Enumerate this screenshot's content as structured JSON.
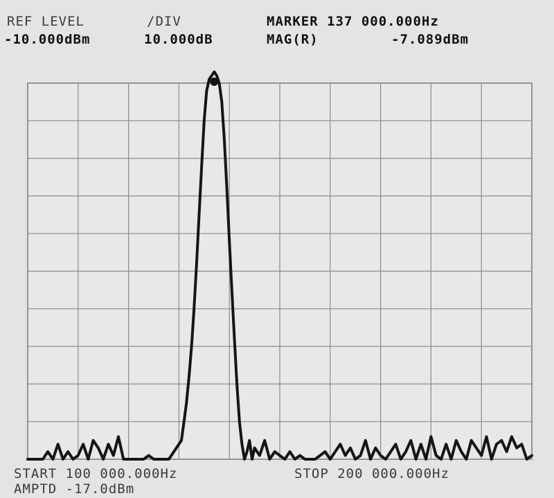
{
  "header": {
    "ref_level_label": "REF LEVEL",
    "ref_level_value": "-10.000dBm",
    "div_label": "/DIV",
    "div_value": "10.000dB",
    "marker_label": "MARKER 137 000.000Hz",
    "marker_mode": "MAG(R)",
    "marker_value": "-7.089dBm"
  },
  "footer": {
    "start": "START 100 000.000Hz",
    "stop": "STOP 200 000.000Hz",
    "amptd": "AMPTD -17.0dBm"
  },
  "chart_data": {
    "type": "line",
    "title": "",
    "xlabel": "",
    "ylabel": "",
    "x_unit": "Hz",
    "y_unit": "dBm",
    "xlim": [
      100000,
      200000
    ],
    "ylim": [
      -110,
      -10
    ],
    "x_divisions": 10,
    "y_divisions": 10,
    "grid": true,
    "marker": {
      "x": 137000,
      "y": -7.089
    },
    "series": [
      {
        "x": [
          100000,
          101000,
          102000,
          103000,
          104000,
          105000,
          106000,
          107000,
          108000,
          109000,
          110000,
          111000,
          112000,
          113000,
          114000,
          115000,
          116000,
          117000,
          118000,
          119000,
          120000,
          121000,
          122000,
          123000,
          124000,
          125000,
          126000,
          127000,
          128000,
          129000,
          130000,
          130500,
          131000,
          131500,
          132000,
          132500,
          133000,
          133500,
          134000,
          134500,
          135000,
          135500,
          136000,
          136500,
          137000,
          137500,
          138000,
          138500,
          139000,
          139500,
          140000,
          140500,
          141000,
          141500,
          142000,
          142500,
          143000,
          143500,
          144000,
          144500,
          145000,
          146000,
          147000,
          148000,
          149000,
          150000,
          151000,
          152000,
          153000,
          154000,
          155000,
          156000,
          157000,
          158000,
          159000,
          160000,
          161000,
          162000,
          163000,
          164000,
          165000,
          166000,
          167000,
          168000,
          169000,
          170000,
          171000,
          172000,
          173000,
          174000,
          175000,
          176000,
          177000,
          178000,
          179000,
          180000,
          181000,
          182000,
          183000,
          184000,
          185000,
          186000,
          187000,
          188000,
          189000,
          190000,
          191000,
          192000,
          193000,
          194000,
          195000,
          196000,
          197000,
          198000,
          199000,
          200000
        ],
        "y": [
          -110,
          -110,
          -110,
          -110,
          -108,
          -110,
          -106,
          -110,
          -108,
          -110,
          -109,
          -106,
          -110,
          -105,
          -107,
          -110,
          -106,
          -109,
          -104,
          -110,
          -110,
          -110,
          -110,
          -110,
          -109,
          -110,
          -110,
          -110,
          -110,
          -108,
          -106,
          -105,
          -100,
          -95,
          -88,
          -80,
          -70,
          -58,
          -45,
          -32,
          -20,
          -12,
          -9,
          -8,
          -7,
          -8,
          -10,
          -15,
          -25,
          -38,
          -52,
          -65,
          -78,
          -90,
          -100,
          -106,
          -110,
          -108,
          -105,
          -110,
          -107,
          -109,
          -105,
          -110,
          -108,
          -109,
          -110,
          -108,
          -110,
          -109,
          -110,
          -110,
          -110,
          -109,
          -108,
          -110,
          -108,
          -106,
          -109,
          -107,
          -110,
          -109,
          -105,
          -110,
          -107,
          -109,
          -110,
          -108,
          -106,
          -110,
          -108,
          -105,
          -110,
          -106,
          -110,
          -104,
          -109,
          -110,
          -106,
          -110,
          -105,
          -108,
          -110,
          -105,
          -107,
          -109,
          -104,
          -110,
          -106,
          -105,
          -108,
          -104,
          -107,
          -106,
          -110,
          -109
        ]
      }
    ]
  }
}
